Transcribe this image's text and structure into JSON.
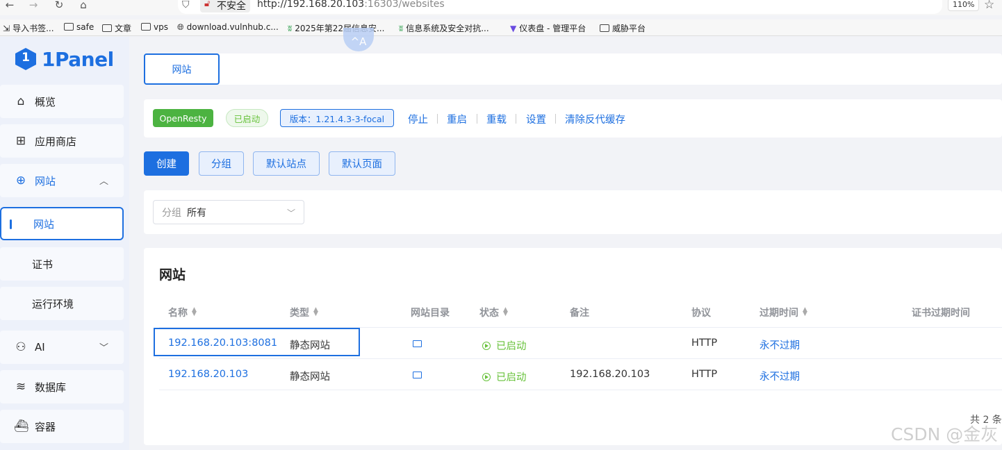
{
  "browser": {
    "security_label": "不安全",
    "url_host": "http://192.168.20.103",
    "url_rest": ":16303/websites",
    "zoom": "110%",
    "bookmarks": [
      {
        "label": "导入书签...",
        "icon": "import-icon"
      },
      {
        "label": "safe",
        "icon": "folder-icon"
      },
      {
        "label": "文章",
        "icon": "folder-icon"
      },
      {
        "label": "vps",
        "icon": "folder-icon"
      },
      {
        "label": "download.vulnhub.c...",
        "icon": "globe-icon"
      },
      {
        "label": "2025年第22届信息安...",
        "icon": "site-icon"
      },
      {
        "label": "信息系统及安全对抗...",
        "icon": "site-icon"
      },
      {
        "label": "仪表盘 - 管理平台",
        "icon": "v-logo-icon"
      },
      {
        "label": "威胁平台",
        "icon": "folder-icon"
      }
    ]
  },
  "float_ball": "^A",
  "sidebar": {
    "logo_text": "1Panel",
    "items": [
      {
        "label": "概览",
        "icon": "home-icon"
      },
      {
        "label": "应用商店",
        "icon": "apps-grid-icon"
      },
      {
        "label": "网站",
        "icon": "globe-icon"
      },
      {
        "label": "网站"
      },
      {
        "label": "证书"
      },
      {
        "label": "运行环境"
      },
      {
        "label": "AI",
        "icon": "robot-icon"
      },
      {
        "label": "数据库",
        "icon": "database-icon"
      },
      {
        "label": "容器",
        "icon": "docker-icon"
      }
    ]
  },
  "main": {
    "tab_label": "网站",
    "server": {
      "name": "OpenResty",
      "status": "已启动",
      "version": "版本：1.21.4.3-3-focal",
      "actions": [
        "停止",
        "重启",
        "重载",
        "设置",
        "清除反代缓存"
      ]
    },
    "toolbar": [
      "创建",
      "分组",
      "默认站点",
      "默认页面"
    ],
    "group_filter": {
      "label": "分组",
      "value": "所有"
    },
    "table": {
      "title": "网站",
      "columns": [
        "名称",
        "类型",
        "网站目录",
        "状态",
        "备注",
        "协议",
        "过期时间",
        "证书过期时间"
      ],
      "rows": [
        {
          "name": "192.168.20.103:8081",
          "type": "静态网站",
          "status": "已启动",
          "remark": "",
          "protocol": "HTTP",
          "expire": "永不过期"
        },
        {
          "name": "192.168.20.103",
          "type": "静态网站",
          "status": "已启动",
          "remark": "192.168.20.103",
          "protocol": "HTTP",
          "expire": "永不过期"
        }
      ],
      "total": "共 2 条"
    }
  },
  "watermark": "CSDN @金灰",
  "colors": {
    "accent": "#1d6fe0",
    "success": "#67c23a",
    "openresty": "#4cb341"
  }
}
